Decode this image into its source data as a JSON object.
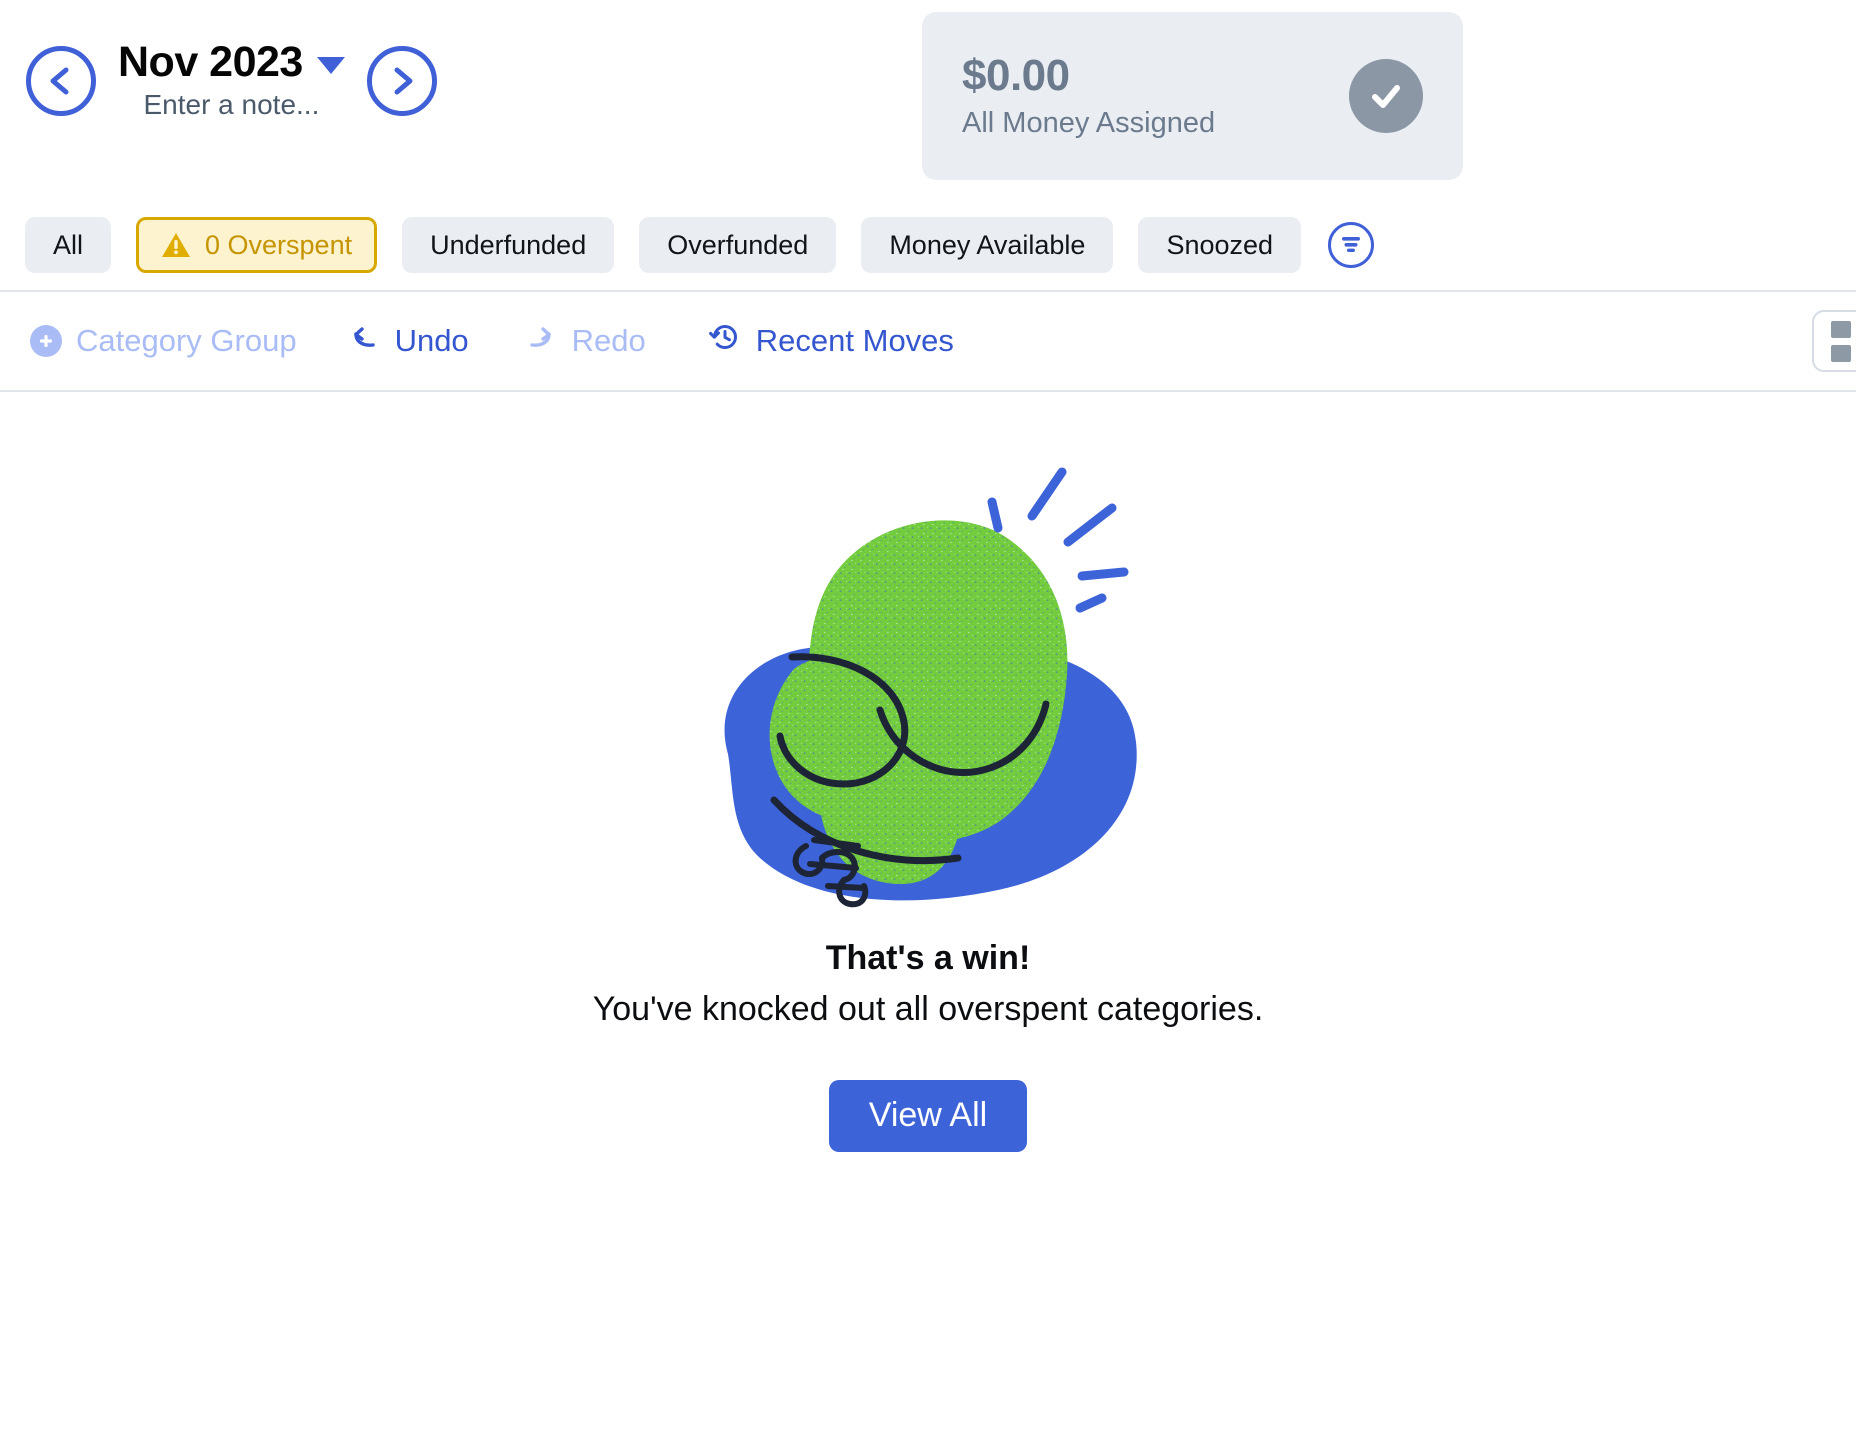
{
  "header": {
    "prev_icon": "chevron-left-icon",
    "next_icon": "chevron-right-icon",
    "month": "Nov 2023",
    "note_placeholder": "Enter a note...",
    "dropdown_icon": "caret-down-icon"
  },
  "money_card": {
    "amount": "$0.00",
    "label": "All Money Assigned",
    "status_icon": "check-circle-icon",
    "background": "#eaeef3",
    "text_color": "#6b7a8d",
    "badge_color": "#8c97a5"
  },
  "filters": {
    "pills": [
      {
        "label": "All",
        "active": false
      },
      {
        "label": "0 Overspent",
        "active": true,
        "icon": "warning-triangle-icon"
      },
      {
        "label": "Underfunded",
        "active": false
      },
      {
        "label": "Overfunded",
        "active": false
      },
      {
        "label": "Money Available",
        "active": false
      },
      {
        "label": "Snoozed",
        "active": false
      }
    ],
    "filter_button_icon": "filter-lines-icon",
    "active_border": "#d6a800",
    "active_fill": "#fdf3cf",
    "active_text": "#c59400",
    "inactive_fill": "#eaeef3"
  },
  "toolbar": {
    "add_category_group": "Category Group",
    "add_icon": "plus-circle-icon",
    "undo": "Undo",
    "undo_icon": "undo-arrow-icon",
    "redo": "Redo",
    "redo_icon": "redo-arrow-icon",
    "recent_moves": "Recent Moves",
    "recent_moves_icon": "clock-history-icon",
    "view_toggle_icon": "layout-columns-icon"
  },
  "empty_state": {
    "illustration": "boxing-glove-illustration",
    "title": "That's a win!",
    "subtitle": "You've knocked out all overspent categories.",
    "button_label": "View All",
    "button_color": "#3d63d8",
    "glove_color": "#72cc3e",
    "blob_color": "#3d63d8",
    "outline_color": "#1c2436"
  }
}
